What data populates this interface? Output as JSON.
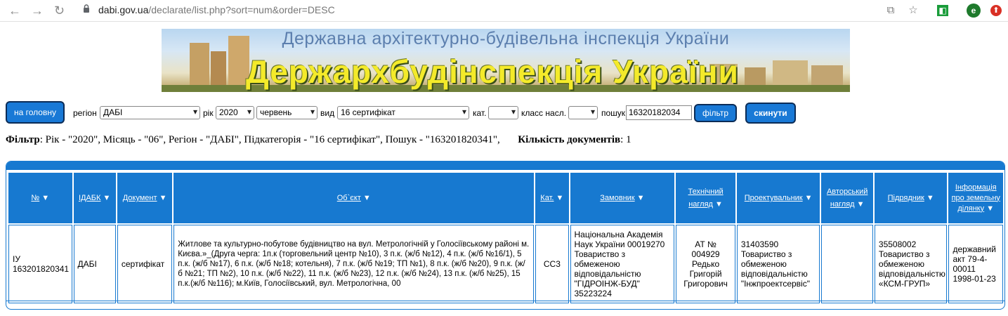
{
  "browser": {
    "url_host": "dabi.gov.ua",
    "url_path": "/declarate/list.php?sort=num&order=DESC",
    "avatar_letter": "e"
  },
  "banner": {
    "line1": "Державна архітектурно-будівельна інспекція України",
    "line2": "Держархбудінспекція України"
  },
  "filters": {
    "home_button": "на головну",
    "region_label": "регіон",
    "region_value": "ДАБІ",
    "year_label": "рік",
    "year_value": "2020",
    "month_value": "червень",
    "type_label": "вид",
    "type_value": "16 сертифікат",
    "cat_label": "кат.",
    "cat_value": "",
    "class_label": "класс насл.",
    "class_value": "",
    "search_label": "пошук",
    "search_value": "16320182034",
    "filter_button": "фільтр",
    "reset_button": "скинути"
  },
  "summary": {
    "filter_label": "Фільтр",
    "filter_text": ": Рік - \"2020\", Місяць - \"06\", Регіон - \"ДАБІ\", Підкатегорія - \"16 сертифікат\", Пошук - \"163201820341\",",
    "count_label": "Кількість документів",
    "count_value": ": 1"
  },
  "table": {
    "headers": [
      "№",
      "ІДАБК",
      "Документ",
      "Об`єкт",
      "Кат.",
      "Замовник",
      "Технічний нагляд",
      "Проектувальник",
      "Авторський нагляд",
      "Підрядник",
      "Інформація про земельну ділянку"
    ],
    "rows": [
      {
        "num": "IУ 163201820341",
        "idabk": "ДАБІ",
        "doc": "сертифікат",
        "object": "Житлове та культурно-побутове будівництво на вул. Метрологічній у Голосіївському районі м. Києва.»_(Друга черга: 1п.к (торговельний центр №10), 3 п.к. (ж/б №12), 4 п.к. (ж/б №16/1), 5 п.к. (ж/б №17), 6 п.к. (ж/б №18; котельня), 7 п.к. (ж/б №19; ТП №1), 8 п.к. (ж/б №20), 9 п.к. (ж/б №21; ТП №2), 10 п.к. (ж/б №22), 11 п.к. (ж/б №23), 12 п.к. (ж/б №24), 13 п.к. (ж/б №25), 15 п.к.(ж/б №116); м.Київ, Голосіївський, вул. Метрологічна, 00",
        "cat": "СС3",
        "customer": "Національна Академія Наук України 00019270 Товариство з обмеженою відповідальністю \"ГІДРОІНЖ-БУД\" 35223224",
        "tech": "АТ № 004929 Редько Григорій Григорович",
        "designer": "31403590 Товариство з обмеженою відповідальністю \"Інжпроектсервіс\"",
        "author": "",
        "contractor": "35508002 Товариство з обмеженою відповідальністю «КСМ-ГРУП»",
        "land": "державний акт 79-4-00011 1998-01-23"
      }
    ]
  },
  "colors": {
    "accent": "#1779d0",
    "button": "#1979d6"
  }
}
